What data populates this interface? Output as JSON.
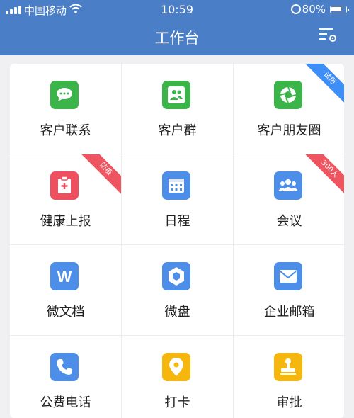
{
  "status_bar": {
    "carrier": "中国移动",
    "time": "10:59",
    "battery": "80%",
    "battery_level": 0.8
  },
  "header": {
    "title": "工作台",
    "settings_icon": "settings-list-icon"
  },
  "colors": {
    "header": "#4a7ec7",
    "green": "#3bb44a",
    "blue": "#4c8ee8",
    "red": "#ef5060",
    "yellow": "#f5b60d",
    "ribbon_blue": "#3e8ef7",
    "ribbon_red": "#ef5560"
  },
  "apps": [
    {
      "label": "客户联系",
      "icon": "chat-bubble-icon",
      "color": "#3bb44a"
    },
    {
      "label": "客户群",
      "icon": "customer-group-icon",
      "color": "#3bb44a"
    },
    {
      "label": "客户朋友圈",
      "icon": "aperture-icon",
      "color": "#3bb44a",
      "ribbon": "试用",
      "ribbon_color": "#3e8ef7"
    },
    {
      "label": "健康上报",
      "icon": "health-report-icon",
      "color": "#ef5060",
      "ribbon": "防疫",
      "ribbon_color": "#ef5560"
    },
    {
      "label": "日程",
      "icon": "calendar-icon",
      "color": "#4c8ee8"
    },
    {
      "label": "会议",
      "icon": "meeting-icon",
      "color": "#4c8ee8",
      "ribbon": "300人",
      "ribbon_color": "#ef5560"
    },
    {
      "label": "微文档",
      "icon": "document-w-icon",
      "color": "#4c8ee8"
    },
    {
      "label": "微盘",
      "icon": "cloud-drive-icon",
      "color": "#4c8ee8"
    },
    {
      "label": "企业邮箱",
      "icon": "mail-icon",
      "color": "#4c8ee8"
    },
    {
      "label": "公费电话",
      "icon": "phone-icon",
      "color": "#4c8ee8"
    },
    {
      "label": "打卡",
      "icon": "location-pin-icon",
      "color": "#f5b60d"
    },
    {
      "label": "审批",
      "icon": "stamp-icon",
      "color": "#f5b60d"
    }
  ]
}
